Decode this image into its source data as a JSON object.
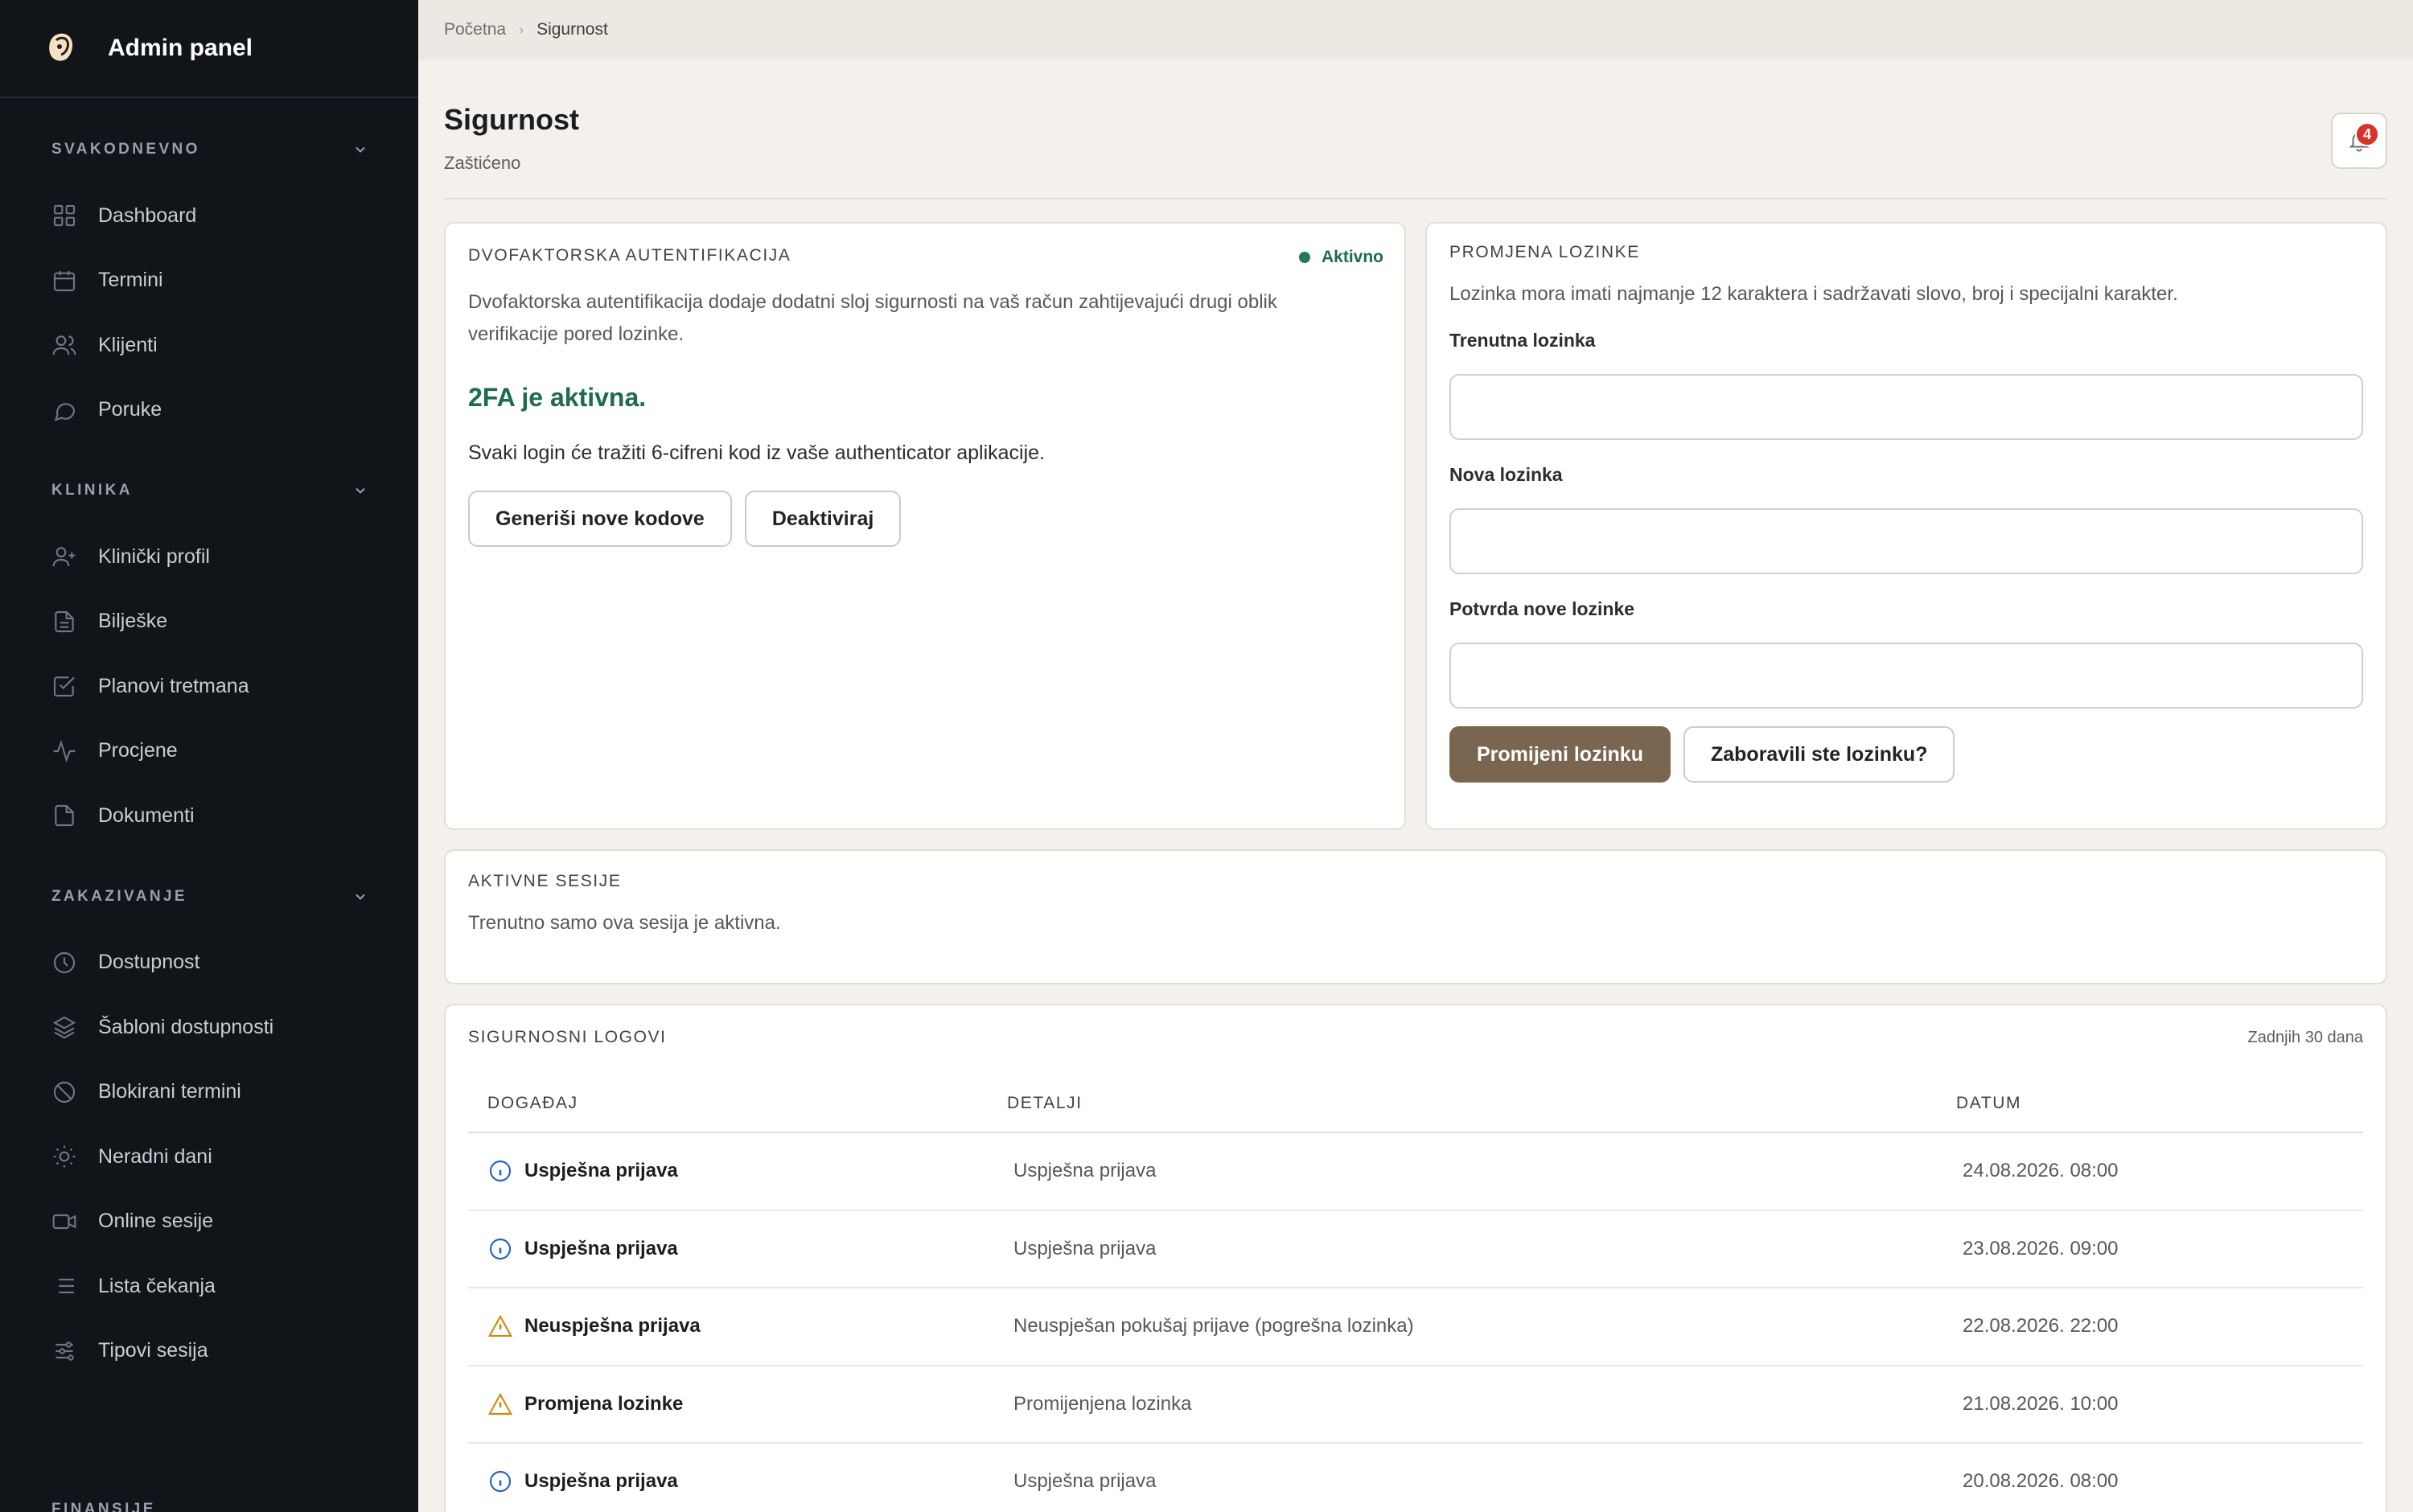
{
  "brand": {
    "title": "Admin panel"
  },
  "sidebar": {
    "sections": [
      {
        "title": "SVAKODNEVNO",
        "items": [
          {
            "label": "Dashboard",
            "icon": "grid-icon"
          },
          {
            "label": "Termini",
            "icon": "calendar-icon"
          },
          {
            "label": "Klijenti",
            "icon": "users-icon"
          },
          {
            "label": "Poruke",
            "icon": "message-icon"
          }
        ]
      },
      {
        "title": "KLINIKA",
        "items": [
          {
            "label": "Klinički profil",
            "icon": "user-plus-icon"
          },
          {
            "label": "Bilješke",
            "icon": "file-text-icon"
          },
          {
            "label": "Planovi tretmana",
            "icon": "check-square-icon"
          },
          {
            "label": "Procjene",
            "icon": "activity-icon"
          },
          {
            "label": "Dokumenti",
            "icon": "file-icon"
          }
        ]
      },
      {
        "title": "ZAKAZIVANJE",
        "items": [
          {
            "label": "Dostupnost",
            "icon": "clock-icon"
          },
          {
            "label": "Šabloni dostupnosti",
            "icon": "layers-icon"
          },
          {
            "label": "Blokirani termini",
            "icon": "ban-icon"
          },
          {
            "label": "Neradni dani",
            "icon": "sun-icon"
          },
          {
            "label": "Online sesije",
            "icon": "video-icon"
          },
          {
            "label": "Lista čekanja",
            "icon": "list-icon"
          },
          {
            "label": "Tipovi sesija",
            "icon": "sliders-icon"
          }
        ]
      }
    ],
    "next_section": "FINANSIJE"
  },
  "breadcrumb": {
    "home": "Početna",
    "current": "Sigurnost"
  },
  "page": {
    "title": "Sigurnost",
    "subtitle": "Zaštićeno"
  },
  "notifications": {
    "count": "4"
  },
  "twofa": {
    "title": "DVOFAKTORSKA AUTENTIFIKACIJA",
    "status": "Aktivno",
    "description": "Dvofaktorska autentifikacija dodaje dodatni sloj sigurnosti na vaš račun zahtijevajući drugi oblik verifikacije pored lozinke.",
    "active_text": "2FA je aktivna.",
    "note": "Svaki login će tražiti 6-cifreni kod iz vaše authenticator aplikacije.",
    "generate_button": "Generiši nove kodove",
    "deactivate_button": "Deaktiviraj"
  },
  "password": {
    "title": "PROMJENA LOZINKE",
    "hint": "Lozinka mora imati najmanje 12 karaktera i sadržavati slovo, broj i specijalni karakter.",
    "current_label": "Trenutna lozinka",
    "new_label": "Nova lozinka",
    "confirm_label": "Potvrda nove lozinke",
    "submit_button": "Promijeni lozinku",
    "forgot_button": "Zaboravili ste lozinku?"
  },
  "sessions": {
    "title": "AKTIVNE SESIJE",
    "text": "Trenutno samo ova sesija je aktivna."
  },
  "logs": {
    "title": "SIGURNOSNI LOGOVI",
    "range": "Zadnjih 30 dana",
    "columns": [
      "DOGAĐAJ",
      "DETALJI",
      "DATUM"
    ],
    "rows": [
      {
        "event": "Uspješna prijava",
        "details": "Uspješna prijava",
        "date": "24.08.2026. 08:00",
        "icon": "info-icon"
      },
      {
        "event": "Uspješna prijava",
        "details": "Uspješna prijava",
        "date": "23.08.2026. 09:00",
        "icon": "info-icon"
      },
      {
        "event": "Neuspješna prijava",
        "details": "Neuspješan pokušaj prijave (pogrešna lozinka)",
        "date": "22.08.2026. 22:00",
        "icon": "warning-icon"
      },
      {
        "event": "Promjena lozinke",
        "details": "Promijenjena lozinka",
        "date": "21.08.2026. 10:00",
        "icon": "warning-icon"
      },
      {
        "event": "Uspješna prijava",
        "details": "Uspješna prijava",
        "date": "20.08.2026. 08:00",
        "icon": "info-icon"
      }
    ]
  },
  "colors": {
    "sidebar_bg": "#111419",
    "page_bg": "#f4f1ec",
    "accent_brown": "#7a6650",
    "success_green": "#1e6b4e",
    "badge_red": "#d9312b",
    "info_blue": "#2563c9",
    "warning_amber": "#d08a12"
  }
}
